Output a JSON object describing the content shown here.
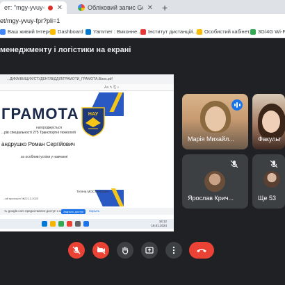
{
  "browser": {
    "tabs": [
      {
        "text": "ет: \"mgy-yvuy-fpr\"",
        "recording": true,
        "close": "✕",
        "active": true
      },
      {
        "text": "Обліковий запис Google",
        "close": "✕",
        "active": false
      }
    ],
    "new_tab": "+",
    "url": "et/mgy-yvuy-fpr?pli=1",
    "bookmarks": [
      {
        "label": "Ваш живий Інтерн...",
        "color": "#4285f4"
      },
      {
        "label": "Dashboard",
        "color": "#fbbc05"
      },
      {
        "label": "Yammer : Виконне...",
        "color": "#0078d4"
      },
      {
        "label": "Інститут дистанцій...",
        "color": "#e53935"
      },
      {
        "label": "Особистий кабінет...",
        "color": "#fbbc05"
      },
      {
        "label": "3G/4G Wi-F",
        "color": "#34a853"
      }
    ]
  },
  "meet": {
    "presentation_title": "менеджменту і логістики на екрані",
    "presentation": {
      "pdf_tab": "...ДИКА/ВИЩИХ/СТУДЕНТ/ВІДДІЛ/ГРАМОТИ_ГРАМОТА.Вiзок.pdf",
      "pdf_toolbar2": "Аа  ✎  ⎘  ⌕",
      "cert_title": "ГРАМОТА",
      "cert_sub": "нагороджується",
      "cert_line1": "...рів спеціальності 275 Транспортні технології",
      "cert_name": "андрушко Роман Сергійович",
      "cert_line2": "за особливі успіхи у навчанні",
      "cert_sign": "Тетяна   МОСТЕНСЬКА",
      "cert_footer": "...ий протокол    №22.12.2023",
      "emblem_text": "НАУ",
      "share_text": "ть google.com предоставлен доступ к вашему экрану",
      "share_button": "Закрыть доступ",
      "share_hide": "Скрыть",
      "clock_time": "16:12",
      "clock_date": "16.01.2024"
    },
    "participants": [
      {
        "name": "Марія Михайл...",
        "speaking": true
      },
      {
        "name": "Факульт",
        "speaking": false
      },
      {
        "name": "Ярослав Крич...",
        "muted": true
      },
      {
        "name": "Ще 53",
        "muted": true
      }
    ],
    "controls": [
      {
        "name": "microphone",
        "state": "off"
      },
      {
        "name": "camera",
        "state": "off"
      },
      {
        "name": "raise-hand",
        "state": "idle"
      },
      {
        "name": "present",
        "state": "idle"
      },
      {
        "name": "more-options",
        "state": "idle"
      },
      {
        "name": "leave-call",
        "state": "idle"
      }
    ]
  }
}
